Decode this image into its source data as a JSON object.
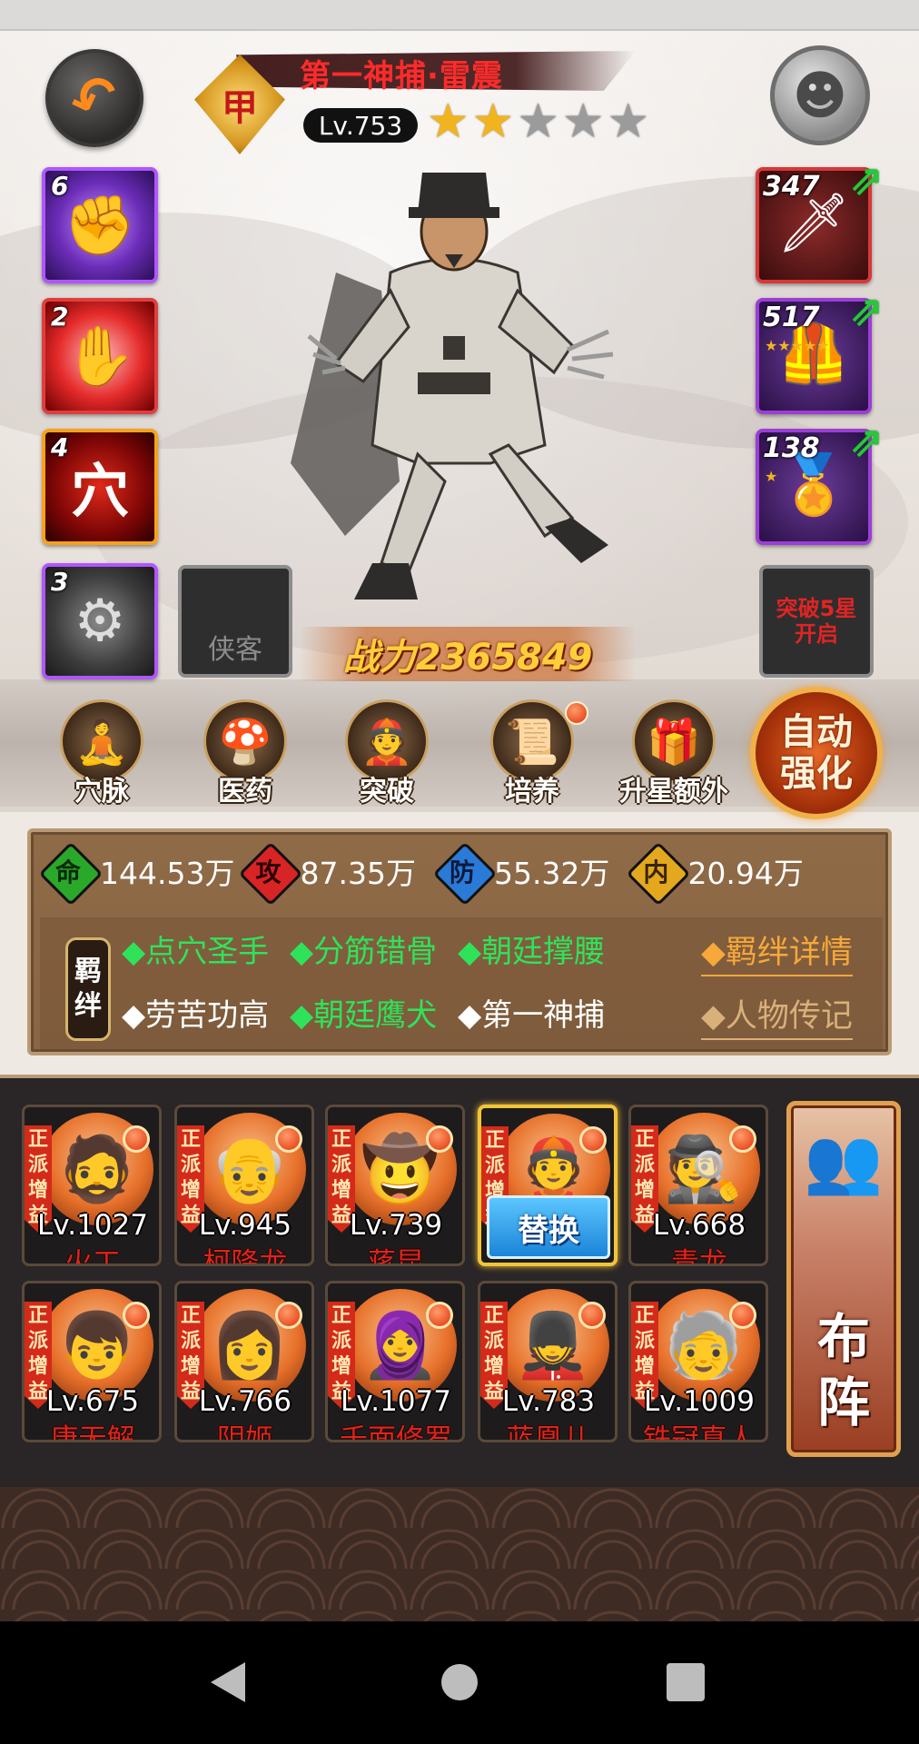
{
  "hero": {
    "title": "第一神捕·雷震",
    "rank_glyph": "甲",
    "level": "Lv.753",
    "stars_on": 2,
    "stars_total": 5,
    "power": "战力2365849"
  },
  "skills": [
    {
      "count": "6",
      "icon": "fist-skill-icon",
      "color": "purple"
    },
    {
      "count": "2",
      "icon": "claw-skill-icon",
      "color": "red"
    },
    {
      "count": "4",
      "icon": "acupoint-skill-icon",
      "color": "orange",
      "glyph": "穴"
    },
    {
      "count": "3",
      "icon": "medallion-skill-icon",
      "color": "purple"
    }
  ],
  "xiake_slot_label": "侠客",
  "equipment": [
    {
      "count": "347",
      "icon": "claw-gauntlet-icon",
      "color": "red",
      "upgradeable": true
    },
    {
      "count": "517",
      "icon": "armor-vest-icon",
      "color": "purple",
      "upgradeable": true,
      "mini_stars": 5
    },
    {
      "count": "138",
      "icon": "token-icon",
      "color": "purple",
      "upgradeable": true,
      "mini_stars": 1
    }
  ],
  "break_slot_label": "突破5星开启",
  "functions": [
    {
      "label": "穴脉",
      "icon": "meditation-icon",
      "badge": false
    },
    {
      "label": "医药",
      "icon": "herb-icon",
      "badge": false
    },
    {
      "label": "突破",
      "icon": "hero-head-icon",
      "badge": false
    },
    {
      "label": "培养",
      "icon": "scroll-icon",
      "badge": true
    },
    {
      "label": "升星额外",
      "icon": "treasure-icon",
      "badge": false
    }
  ],
  "auto_strengthen_label": "自动强化",
  "stats": [
    {
      "key": "命",
      "value": "144.53万",
      "color": "#2aa82a"
    },
    {
      "key": "攻",
      "value": "87.35万",
      "color": "#d82424"
    },
    {
      "key": "防",
      "value": "55.32万",
      "color": "#2a7ad8"
    },
    {
      "key": "内",
      "value": "20.94万",
      "color": "#e3a81e"
    }
  ],
  "bond_tag": "羁绊",
  "bonds_row1": [
    {
      "text": "◆点穴圣手",
      "active": true
    },
    {
      "text": "◆分筋错骨",
      "active": true
    },
    {
      "text": "◆朝廷撑腰",
      "active": true
    }
  ],
  "bonds_row2": [
    {
      "text": "◆劳苦功高",
      "active": false
    },
    {
      "text": "◆朝廷鹰犬",
      "active": true
    },
    {
      "text": "◆第一神捕",
      "active": false
    }
  ],
  "bond_detail_link": "◆羁绊详情",
  "biography_link": "◆人物传记",
  "roster_faction_label": "正派增益",
  "roster": [
    {
      "level": "Lv.1027",
      "name": "火工",
      "icon": "bearded-warrior-icon"
    },
    {
      "level": "Lv.945",
      "name": "柯降龙",
      "icon": "elder-icon"
    },
    {
      "level": "Lv.739",
      "name": "蒋昆",
      "icon": "hat-warrior-icon"
    },
    {
      "level": "",
      "name": "",
      "icon": "constable-icon",
      "active": true,
      "action": "替换"
    },
    {
      "level": "Lv.668",
      "name": "青龙",
      "icon": "masked-hat-icon"
    },
    {
      "level": "Lv.675",
      "name": "唐无解",
      "icon": "young-hero-icon"
    },
    {
      "level": "Lv.766",
      "name": "阴姬",
      "icon": "lady-icon"
    },
    {
      "level": "Lv.1077",
      "name": "千面修罗",
      "icon": "hooded-lady-icon"
    },
    {
      "level": "Lv.783",
      "name": "蓝凰儿",
      "icon": "silver-helmet-icon"
    },
    {
      "level": "Lv.1009",
      "name": "铁冠真人",
      "icon": "white-haired-elder-icon"
    }
  ],
  "formation_label": [
    "布",
    "阵"
  ]
}
